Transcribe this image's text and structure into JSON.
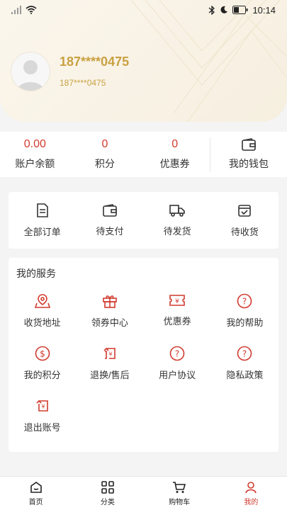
{
  "status_bar": {
    "time": "10:14"
  },
  "profile": {
    "name": "187****0475",
    "phone": "187****0475"
  },
  "stats": [
    {
      "value": "0.00",
      "label": "账户余额"
    },
    {
      "value": "0",
      "label": "积分"
    },
    {
      "value": "0",
      "label": "优惠券"
    }
  ],
  "wallet": {
    "label": "我的钱包",
    "icon": "wallet-icon"
  },
  "orders": [
    {
      "label": "全部订单",
      "icon": "document-icon"
    },
    {
      "label": "待支付",
      "icon": "wallet-icon"
    },
    {
      "label": "待发货",
      "icon": "truck-icon"
    },
    {
      "label": "待收货",
      "icon": "box-check-icon"
    }
  ],
  "services": {
    "title": "我的服务",
    "items": [
      {
        "label": "收货地址",
        "icon": "location-icon"
      },
      {
        "label": "领券中心",
        "icon": "gift-icon"
      },
      {
        "label": "优惠券",
        "icon": "coupon-icon"
      },
      {
        "label": "我的帮助",
        "icon": "help-icon"
      },
      {
        "label": "我的积分",
        "icon": "dollar-icon"
      },
      {
        "label": "退换/售后",
        "icon": "exchange-icon"
      },
      {
        "label": "用户协议",
        "icon": "help-icon"
      },
      {
        "label": "隐私政策",
        "icon": "help-icon"
      },
      {
        "label": "退出账号",
        "icon": "logout-yen-icon"
      }
    ]
  },
  "tabbar": [
    {
      "label": "首页",
      "icon": "home-icon"
    },
    {
      "label": "分类",
      "icon": "grid-icon"
    },
    {
      "label": "购物车",
      "icon": "cart-icon"
    },
    {
      "label": "我的",
      "icon": "user-icon",
      "active": true
    }
  ],
  "colors": {
    "accent": "#d23a2e",
    "gold": "#c9a142"
  }
}
